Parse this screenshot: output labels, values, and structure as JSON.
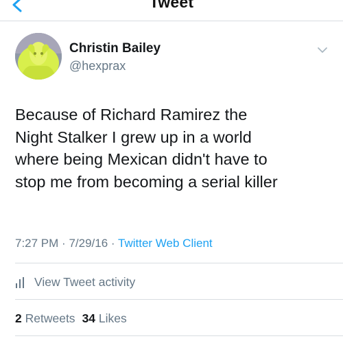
{
  "nav": {
    "title": "Tweet"
  },
  "user": {
    "name": "Christin Bailey",
    "handle": "@hexprax"
  },
  "tweet": {
    "lines": [
      "Because of Richard Ramirez the",
      "Night Stalker I grew up in a world",
      "where being Mexican didn't have to",
      "stop me from becoming a serial killer"
    ],
    "time": "7:27 PM",
    "separator": "·",
    "date": "7/29/16",
    "client": "Twitter Web Client"
  },
  "activity": {
    "label": "View Tweet activity"
  },
  "stats": {
    "retweets_count": "2",
    "retweets_label": "Retweets",
    "likes_count": "34",
    "likes_label": "Likes"
  },
  "colors": {
    "link": "#1da1f2",
    "secondary_text": "#657786",
    "primary_text": "#14171a",
    "divider": "#d8dde1"
  },
  "icons": {
    "back": "chevron-left-icon",
    "menu": "chevron-down-icon",
    "activity": "bar-chart-icon"
  }
}
